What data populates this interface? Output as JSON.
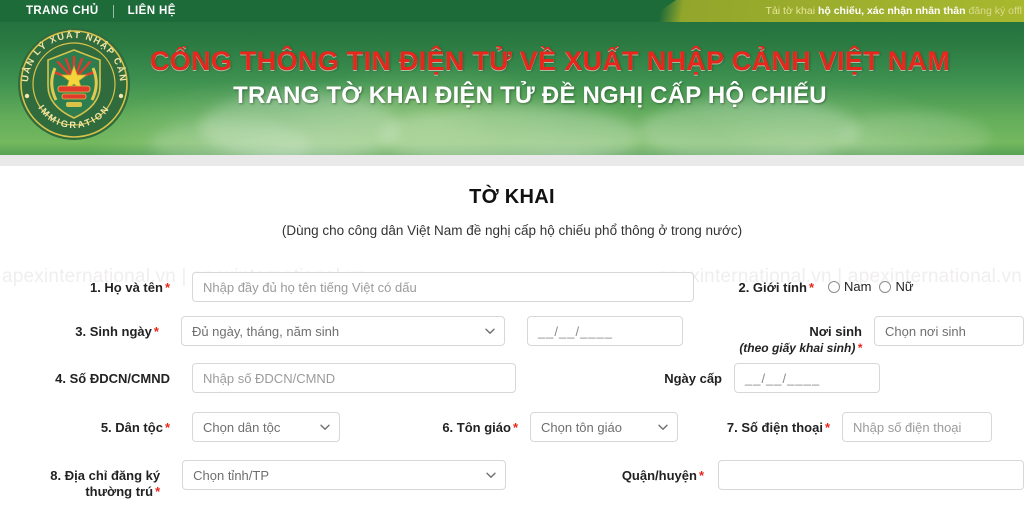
{
  "nav": {
    "items": [
      {
        "label": "TRANG CHỦ"
      },
      {
        "label": "LIÊN HỆ"
      }
    ]
  },
  "ticker": {
    "prefix": "Tải tờ khai ",
    "bold1": "hộ chiếu, xác nhận nhân thân ",
    "suffix": "đăng ký offl"
  },
  "emblem": {
    "top_arc": "QUẢN LÝ XUẤT NHẬP CẢNH",
    "bottom_arc": "IMMIGRATION"
  },
  "header": {
    "title_main": "CỔNG THÔNG TIN ĐIỆN TỬ VỀ XUẤT NHẬP CẢNH VIỆT NAM",
    "title_sub": "TRANG TỜ KHAI ĐIỆN TỬ ĐỀ NGHỊ CẤP HỘ CHIẾU"
  },
  "form": {
    "title": "TỜ KHAI",
    "subtitle": "(Dùng cho công dân Việt Nam đề nghị cấp hộ chiếu phổ thông ở trong nước)",
    "watermark_left": "apexinternational.vn  |  apexinternational.vn",
    "watermark_right": "apexinternational.vn   |   apexinternational.vn",
    "fields": {
      "fullname": {
        "label": "1. Họ và tên",
        "required": "*",
        "placeholder": "Nhập đầy đủ họ tên tiếng Việt có dấu",
        "value": ""
      },
      "gender": {
        "label": "2. Giới tính",
        "required": "*",
        "option_male": "Nam",
        "option_female": "Nữ"
      },
      "birthdate": {
        "label": "3. Sinh ngày",
        "required": "*",
        "select_value": "Đủ ngày, tháng, năm sinh",
        "date_value": "__/__/____"
      },
      "birthplace": {
        "label": "Nơi sinh",
        "note": "(theo giấy khai sinh)",
        "required": "*",
        "select_value": "Chọn nơi sinh"
      },
      "idnumber": {
        "label": "4. Số ĐDCN/CMND",
        "required": "",
        "placeholder": "Nhập số ĐDCN/CMND",
        "value": ""
      },
      "issuedate": {
        "label": "Ngày cấp",
        "required": "",
        "date_value": "__/__/____"
      },
      "ethnicity": {
        "label": "5. Dân tộc",
        "required": "*",
        "select_value": "Chọn dân tộc"
      },
      "religion": {
        "label": "6. Tôn giáo",
        "required": "*",
        "select_value": "Chọn tôn giáo"
      },
      "phone": {
        "label": "7. Số điện thoại",
        "required": "*",
        "placeholder": "Nhập số điện thoại",
        "value": ""
      },
      "address": {
        "label": "8. Địa chỉ đăng ký",
        "label2": "thường trú",
        "required": "*",
        "select_value": "Chọn tỉnh/TP"
      },
      "district": {
        "label": "Quận/huyện",
        "required": "*",
        "placeholder": "",
        "value": ""
      }
    }
  },
  "colors": {
    "header_dark_green": "#1d6b39",
    "header_light_green": "#74b85f",
    "title_red": "#e8261c",
    "ticker_olive": "#a8b82e",
    "required_red": "#e8261c"
  }
}
